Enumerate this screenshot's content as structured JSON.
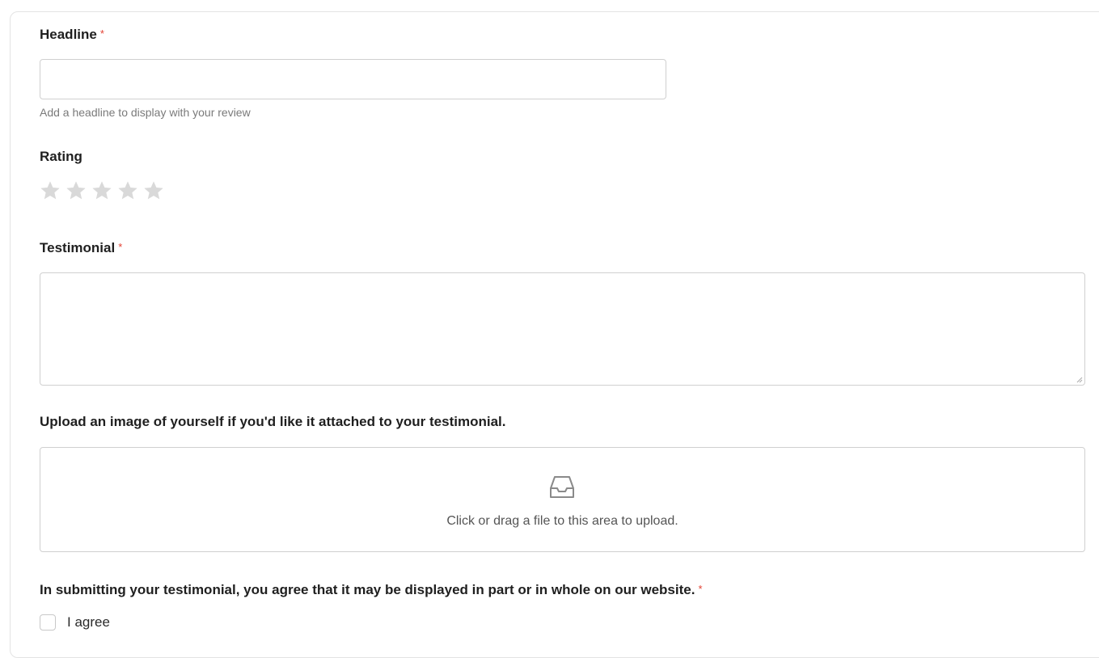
{
  "headline": {
    "label": "Headline",
    "required_mark": "*",
    "value": "",
    "help_text": "Add a headline to display with your review"
  },
  "rating": {
    "label": "Rating",
    "value": 0,
    "max": 5,
    "star_color": "#d9d9d9"
  },
  "testimonial": {
    "label": "Testimonial",
    "required_mark": "*",
    "value": ""
  },
  "upload": {
    "label": "Upload an image of yourself if you'd like it attached to your testimonial.",
    "prompt": "Click or drag a file to this area to upload.",
    "icon": "inbox-icon"
  },
  "consent": {
    "label": "In submitting your testimonial, you agree that it may be displayed in part or in whole on our website.",
    "required_mark": "*",
    "checkbox_label": "I agree",
    "checked": false
  },
  "colors": {
    "required": "#e34234",
    "border": "#d0d0d0"
  }
}
